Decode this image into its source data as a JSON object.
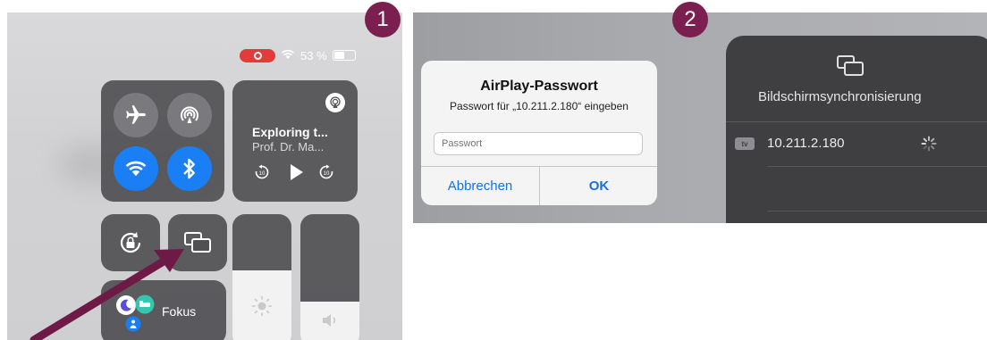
{
  "badges": {
    "step1": "1",
    "step2": "2"
  },
  "status": {
    "battery_text": "53 %",
    "battery_level": 0.53
  },
  "media": {
    "title": "Exploring t...",
    "subtitle": "Prof. Dr. Ma..."
  },
  "focus": {
    "label": "Fokus"
  },
  "sliders": {
    "brightness_level": 0.58,
    "volume_level": 0.35
  },
  "dialog": {
    "title": "AirPlay-Passwort",
    "message": "Passwort für „10.211.2.180“ eingeben",
    "placeholder": "Passwort",
    "cancel_label": "Abbrechen",
    "ok_label": "OK"
  },
  "mirroring": {
    "title": "Bildschirmsynchronisierung",
    "device_badge": "tv",
    "device_ip": "10.211.2.180"
  },
  "colors": {
    "accent_blue": "#1a7ff5",
    "badge": "#7b1f50",
    "arrow": "#6e1a47",
    "record": "#e33a3a"
  },
  "icons": [
    "airplane-icon",
    "airdrop-icon",
    "wifi-icon",
    "bluetooth-icon",
    "airplay-audio-icon",
    "skip-back-icon",
    "play-icon",
    "skip-forward-icon",
    "rotation-lock-icon",
    "screen-mirroring-icon",
    "moon-icon",
    "bed-icon",
    "person-icon",
    "sun-icon",
    "speaker-icon",
    "spinner-icon"
  ]
}
